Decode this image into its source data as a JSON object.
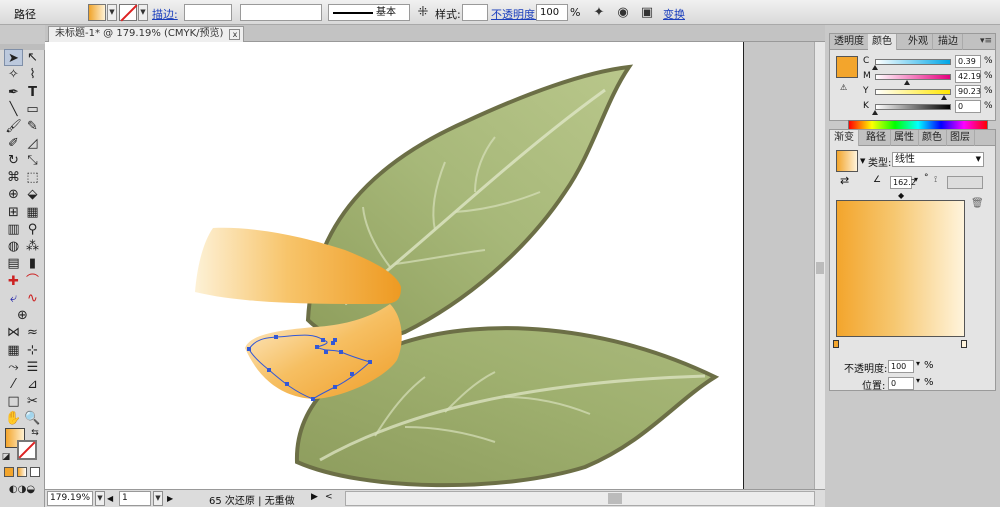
{
  "control_bar": {
    "selection_label": "路径",
    "stroke_link": "描边:",
    "stroke_weight": "",
    "brush_definition": "基本",
    "style_label": "样式:",
    "opacity_link": "不透明度:",
    "opacity_value": "100",
    "opacity_unit": "%",
    "transform_link": "变换"
  },
  "document_tab": {
    "title": "未标题-1* @ 179.19% (CMYK/预览)",
    "close": "x"
  },
  "status_bar": {
    "zoom": "179.19%",
    "page": "1",
    "status": "65 次还原 | 无重做"
  },
  "color_panel": {
    "tabs": [
      "透明度",
      "颜色",
      "外观",
      "描边"
    ],
    "active_tab": "颜色",
    "fill_color": "#f3a52c",
    "channels": [
      {
        "name": "C",
        "value": "0.39",
        "unit": "%",
        "level": 0.0039
      },
      {
        "name": "M",
        "value": "42.19",
        "unit": "%",
        "level": 0.4219
      },
      {
        "name": "Y",
        "value": "90.23",
        "unit": "%",
        "level": 0.9023
      },
      {
        "name": "K",
        "value": "0",
        "unit": "%",
        "level": 0
      }
    ]
  },
  "gradient_panel": {
    "tabs": [
      "渐变",
      "路径",
      "属性",
      "颜色",
      "图层"
    ],
    "active_tab": "渐变",
    "type_label": "类型:",
    "type_value": "线性",
    "angle_value": "162.2",
    "stops": [
      {
        "color": "#f3a52c",
        "location": 0
      },
      {
        "color": "#fff4dc",
        "location": 100
      }
    ],
    "opacity_label": "不透明度:",
    "opacity_value": "100",
    "position_label": "位置:",
    "position_value": "0",
    "percent": "%"
  },
  "colors": {
    "orange": "#f3a52c",
    "leaf_green": "#9bab6b",
    "leaf_edge": "#6c6f46",
    "path_blue": "#3358d6",
    "link_blue": "#1b3fbd"
  }
}
